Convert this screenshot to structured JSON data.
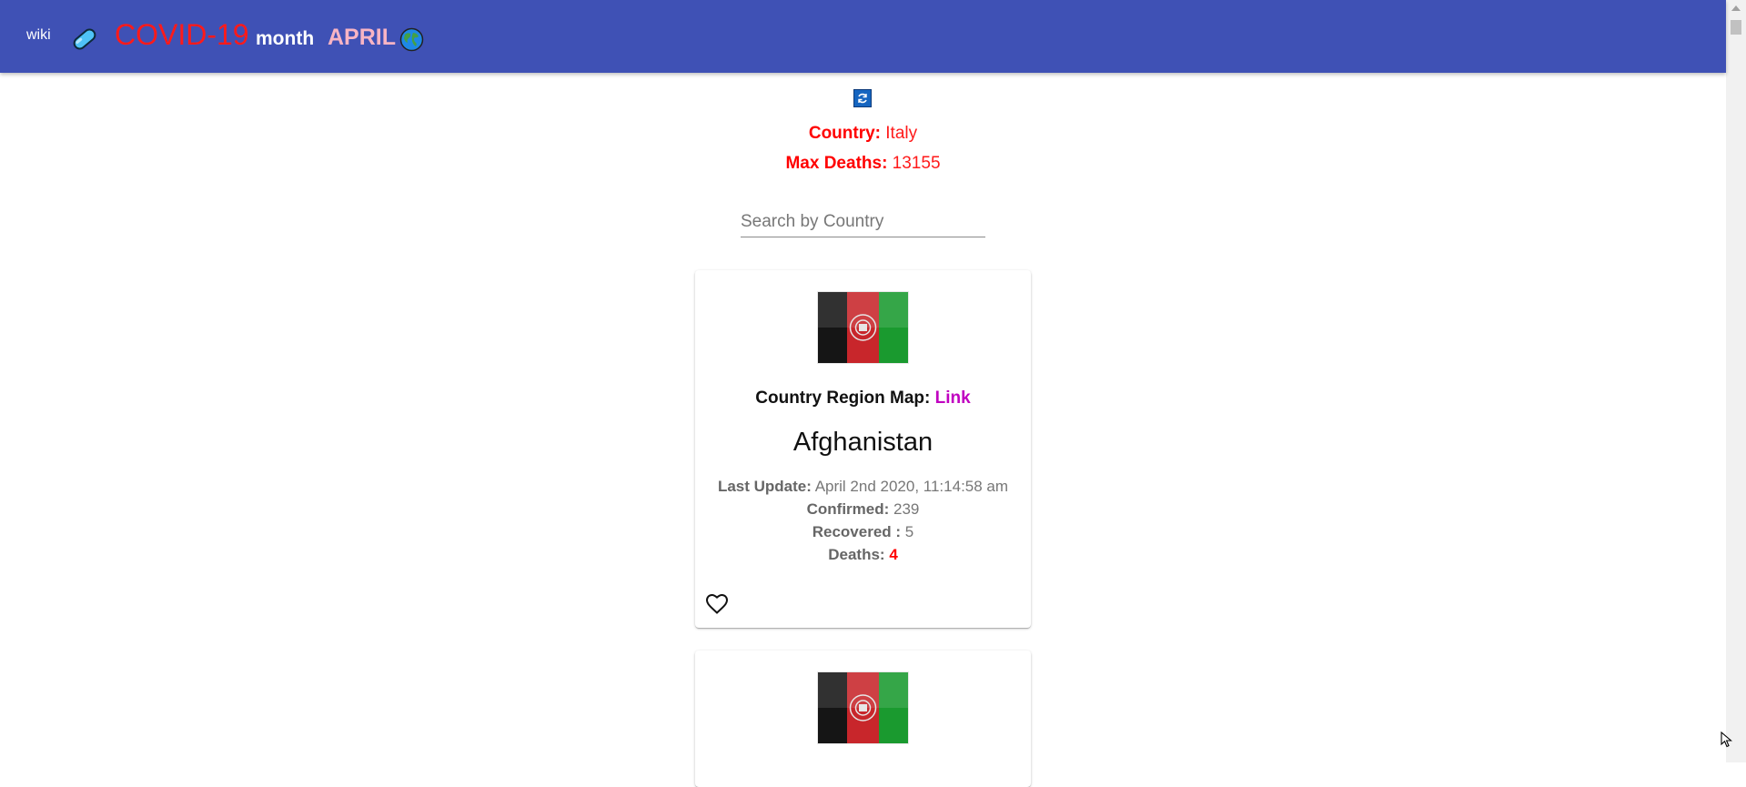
{
  "header": {
    "wiki_label": "wiki",
    "title": "COVID-19",
    "month_label": "month",
    "month_value": "APRIL",
    "pill_icon": "pill-icon",
    "globe_icon": "globe-icon",
    "bar_color": "#3f51b5"
  },
  "summary": {
    "country_label": "Country:",
    "country_value": "Italy",
    "max_deaths_label": "Max Deaths:",
    "max_deaths_value": "13155"
  },
  "search": {
    "placeholder": "Search by Country",
    "value": ""
  },
  "cards": [
    {
      "flag_icon": "afghanistan-flag",
      "region_label": "Country Region Map:",
      "region_link": "Link",
      "country": "Afghanistan",
      "last_update_label": "Last Update:",
      "last_update_value": "April 2nd 2020, 11:14:58 am",
      "confirmed_label": "Confirmed:",
      "confirmed_value": "239",
      "recovered_label": "Recovered :",
      "recovered_value": "5",
      "deaths_label": "Deaths:",
      "deaths_value": "4",
      "favorite_icon": "heart-outline-icon"
    },
    {
      "flag_icon": "afghanistan-flag"
    }
  ]
}
